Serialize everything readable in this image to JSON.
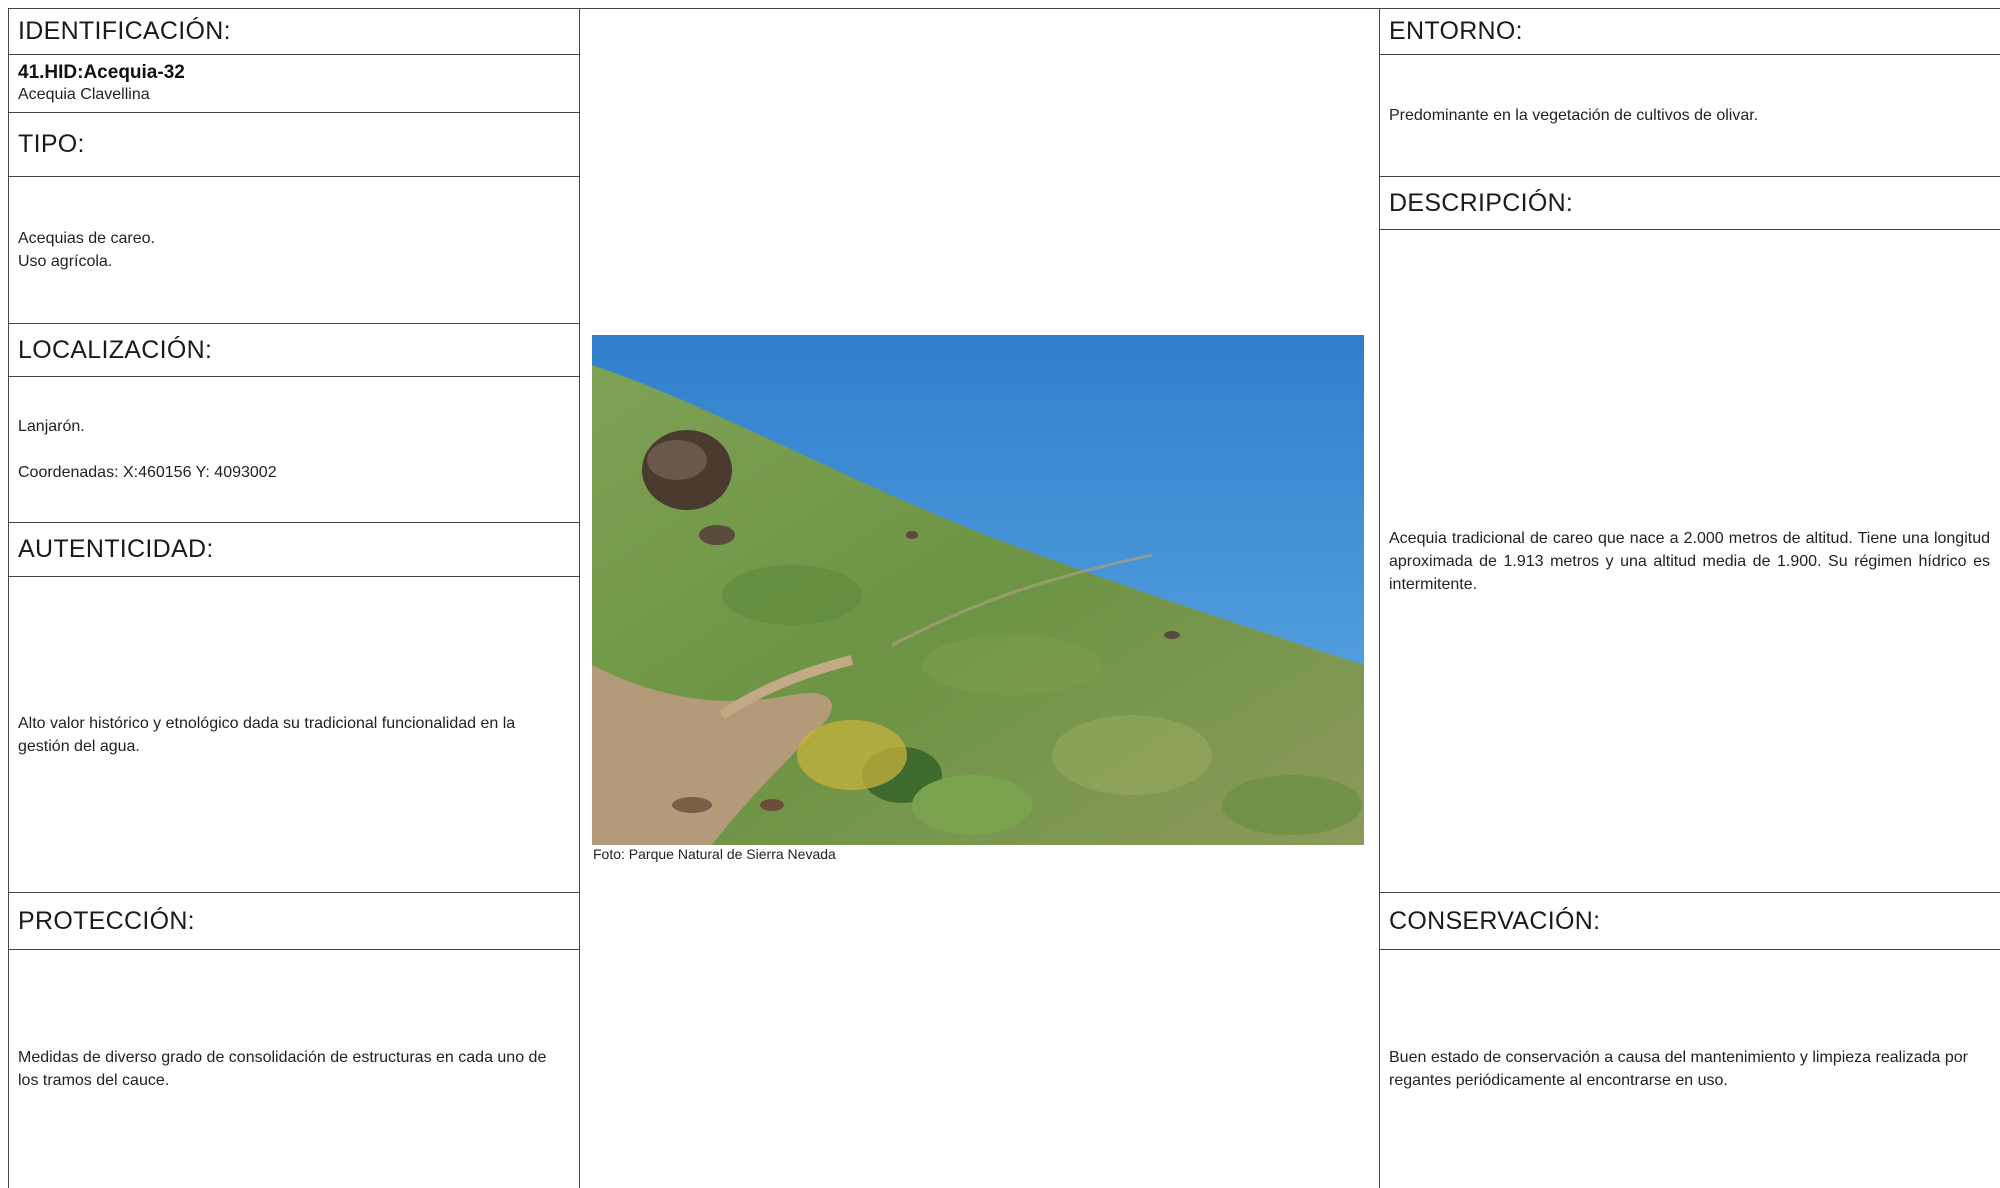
{
  "identificacion": {
    "label": "IDENTIFICACIÓN:",
    "code": "41.HID:Acequia-32",
    "name": "Acequia Clavellina"
  },
  "tipo": {
    "label": "TIPO:",
    "line1": "Acequias de careo.",
    "line2": "Uso agrícola."
  },
  "localizacion": {
    "label": "LOCALIZACIÓN:",
    "place": "Lanjarón.",
    "coords": "Coordenadas: X:460156 Y: 4093002"
  },
  "autenticidad": {
    "label": "AUTENTICIDAD:",
    "text": "Alto valor histórico y etnológico dada su tradicional funcionalidad en la gestión del agua."
  },
  "proteccion": {
    "label": "PROTECCIÓN:",
    "text": "Medidas de diverso grado de consolidación de estructuras en cada uno de los tramos del cauce."
  },
  "entorno": {
    "label": "ENTORNO:",
    "text": "Predominante en la vegetación de cultivos de olivar."
  },
  "descripcion": {
    "label": "DESCRIPCIÓN:",
    "text": "Acequia tradicional de careo que nace a 2.000 metros de altitud. Tiene una longitud aproximada de 1.913 metros y una altitud media de 1.900. Su régimen hídrico es intermitente."
  },
  "conservacion": {
    "label": "CONSERVACIÓN:",
    "text": "Buen estado de conservación a causa del mantenimiento y limpieza realizada por regantes periódicamente al encontrarse en uso."
  },
  "photo": {
    "caption": "Foto: Parque Natural de Sierra Nevada",
    "sky_color": "#3d8fd6",
    "grass_color": "#6f9a45"
  }
}
